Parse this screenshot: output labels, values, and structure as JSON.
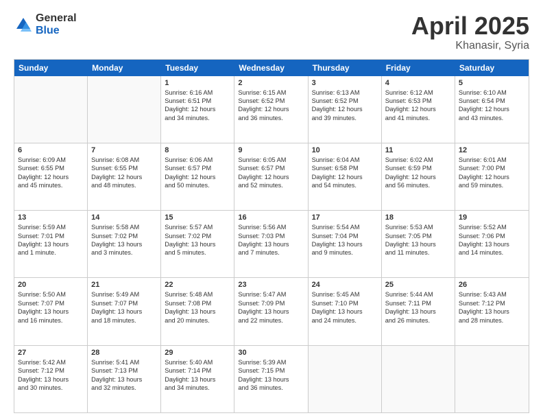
{
  "logo": {
    "general": "General",
    "blue": "Blue"
  },
  "title": "April 2025",
  "location": "Khanasir, Syria",
  "header_days": [
    "Sunday",
    "Monday",
    "Tuesday",
    "Wednesday",
    "Thursday",
    "Friday",
    "Saturday"
  ],
  "weeks": [
    [
      {
        "day": "",
        "lines": []
      },
      {
        "day": "",
        "lines": []
      },
      {
        "day": "1",
        "lines": [
          "Sunrise: 6:16 AM",
          "Sunset: 6:51 PM",
          "Daylight: 12 hours",
          "and 34 minutes."
        ]
      },
      {
        "day": "2",
        "lines": [
          "Sunrise: 6:15 AM",
          "Sunset: 6:52 PM",
          "Daylight: 12 hours",
          "and 36 minutes."
        ]
      },
      {
        "day": "3",
        "lines": [
          "Sunrise: 6:13 AM",
          "Sunset: 6:52 PM",
          "Daylight: 12 hours",
          "and 39 minutes."
        ]
      },
      {
        "day": "4",
        "lines": [
          "Sunrise: 6:12 AM",
          "Sunset: 6:53 PM",
          "Daylight: 12 hours",
          "and 41 minutes."
        ]
      },
      {
        "day": "5",
        "lines": [
          "Sunrise: 6:10 AM",
          "Sunset: 6:54 PM",
          "Daylight: 12 hours",
          "and 43 minutes."
        ]
      }
    ],
    [
      {
        "day": "6",
        "lines": [
          "Sunrise: 6:09 AM",
          "Sunset: 6:55 PM",
          "Daylight: 12 hours",
          "and 45 minutes."
        ]
      },
      {
        "day": "7",
        "lines": [
          "Sunrise: 6:08 AM",
          "Sunset: 6:55 PM",
          "Daylight: 12 hours",
          "and 48 minutes."
        ]
      },
      {
        "day": "8",
        "lines": [
          "Sunrise: 6:06 AM",
          "Sunset: 6:57 PM",
          "Daylight: 12 hours",
          "and 50 minutes."
        ]
      },
      {
        "day": "9",
        "lines": [
          "Sunrise: 6:05 AM",
          "Sunset: 6:57 PM",
          "Daylight: 12 hours",
          "and 52 minutes."
        ]
      },
      {
        "day": "10",
        "lines": [
          "Sunrise: 6:04 AM",
          "Sunset: 6:58 PM",
          "Daylight: 12 hours",
          "and 54 minutes."
        ]
      },
      {
        "day": "11",
        "lines": [
          "Sunrise: 6:02 AM",
          "Sunset: 6:59 PM",
          "Daylight: 12 hours",
          "and 56 minutes."
        ]
      },
      {
        "day": "12",
        "lines": [
          "Sunrise: 6:01 AM",
          "Sunset: 7:00 PM",
          "Daylight: 12 hours",
          "and 59 minutes."
        ]
      }
    ],
    [
      {
        "day": "13",
        "lines": [
          "Sunrise: 5:59 AM",
          "Sunset: 7:01 PM",
          "Daylight: 13 hours",
          "and 1 minute."
        ]
      },
      {
        "day": "14",
        "lines": [
          "Sunrise: 5:58 AM",
          "Sunset: 7:02 PM",
          "Daylight: 13 hours",
          "and 3 minutes."
        ]
      },
      {
        "day": "15",
        "lines": [
          "Sunrise: 5:57 AM",
          "Sunset: 7:02 PM",
          "Daylight: 13 hours",
          "and 5 minutes."
        ]
      },
      {
        "day": "16",
        "lines": [
          "Sunrise: 5:56 AM",
          "Sunset: 7:03 PM",
          "Daylight: 13 hours",
          "and 7 minutes."
        ]
      },
      {
        "day": "17",
        "lines": [
          "Sunrise: 5:54 AM",
          "Sunset: 7:04 PM",
          "Daylight: 13 hours",
          "and 9 minutes."
        ]
      },
      {
        "day": "18",
        "lines": [
          "Sunrise: 5:53 AM",
          "Sunset: 7:05 PM",
          "Daylight: 13 hours",
          "and 11 minutes."
        ]
      },
      {
        "day": "19",
        "lines": [
          "Sunrise: 5:52 AM",
          "Sunset: 7:06 PM",
          "Daylight: 13 hours",
          "and 14 minutes."
        ]
      }
    ],
    [
      {
        "day": "20",
        "lines": [
          "Sunrise: 5:50 AM",
          "Sunset: 7:07 PM",
          "Daylight: 13 hours",
          "and 16 minutes."
        ]
      },
      {
        "day": "21",
        "lines": [
          "Sunrise: 5:49 AM",
          "Sunset: 7:07 PM",
          "Daylight: 13 hours",
          "and 18 minutes."
        ]
      },
      {
        "day": "22",
        "lines": [
          "Sunrise: 5:48 AM",
          "Sunset: 7:08 PM",
          "Daylight: 13 hours",
          "and 20 minutes."
        ]
      },
      {
        "day": "23",
        "lines": [
          "Sunrise: 5:47 AM",
          "Sunset: 7:09 PM",
          "Daylight: 13 hours",
          "and 22 minutes."
        ]
      },
      {
        "day": "24",
        "lines": [
          "Sunrise: 5:45 AM",
          "Sunset: 7:10 PM",
          "Daylight: 13 hours",
          "and 24 minutes."
        ]
      },
      {
        "day": "25",
        "lines": [
          "Sunrise: 5:44 AM",
          "Sunset: 7:11 PM",
          "Daylight: 13 hours",
          "and 26 minutes."
        ]
      },
      {
        "day": "26",
        "lines": [
          "Sunrise: 5:43 AM",
          "Sunset: 7:12 PM",
          "Daylight: 13 hours",
          "and 28 minutes."
        ]
      }
    ],
    [
      {
        "day": "27",
        "lines": [
          "Sunrise: 5:42 AM",
          "Sunset: 7:12 PM",
          "Daylight: 13 hours",
          "and 30 minutes."
        ]
      },
      {
        "day": "28",
        "lines": [
          "Sunrise: 5:41 AM",
          "Sunset: 7:13 PM",
          "Daylight: 13 hours",
          "and 32 minutes."
        ]
      },
      {
        "day": "29",
        "lines": [
          "Sunrise: 5:40 AM",
          "Sunset: 7:14 PM",
          "Daylight: 13 hours",
          "and 34 minutes."
        ]
      },
      {
        "day": "30",
        "lines": [
          "Sunrise: 5:39 AM",
          "Sunset: 7:15 PM",
          "Daylight: 13 hours",
          "and 36 minutes."
        ]
      },
      {
        "day": "",
        "lines": []
      },
      {
        "day": "",
        "lines": []
      },
      {
        "day": "",
        "lines": []
      }
    ]
  ]
}
